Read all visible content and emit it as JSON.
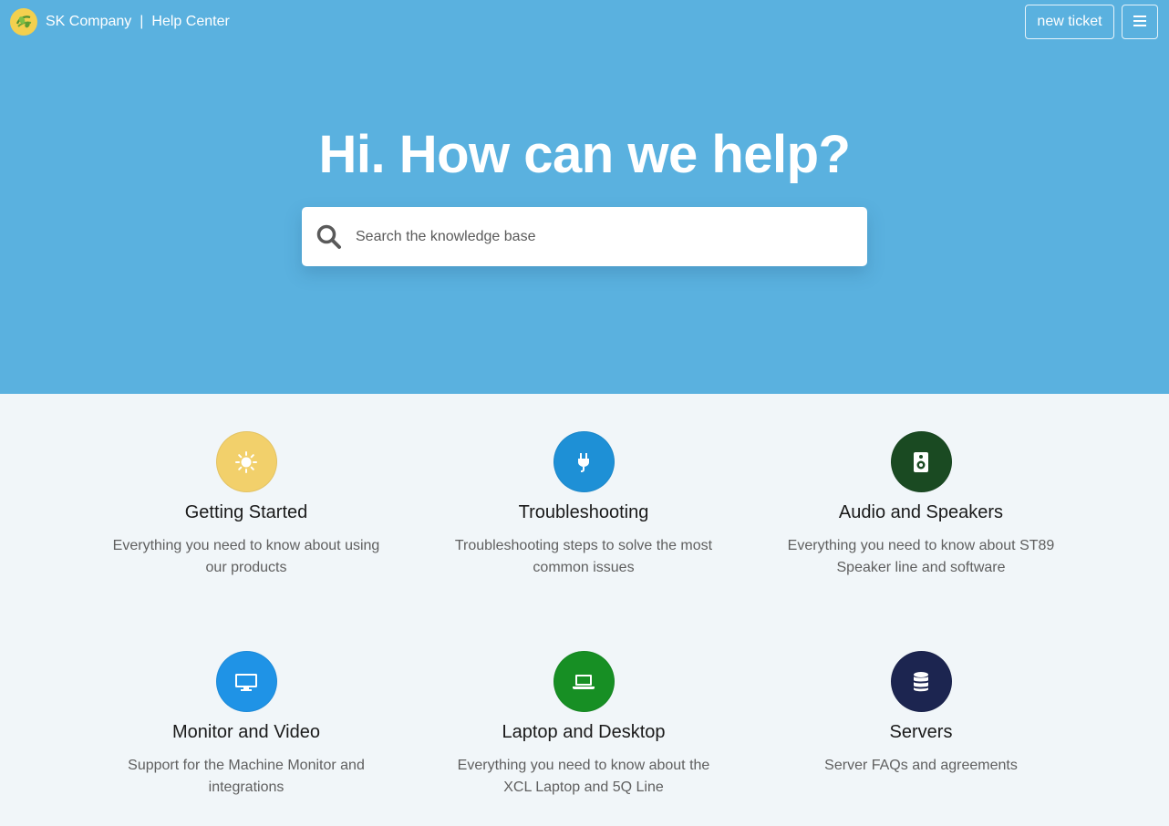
{
  "header": {
    "company": "SK Company",
    "separator": "|",
    "section": "Help Center",
    "new_ticket_label": "new ticket",
    "menu_icon": "hamburger-menu-icon"
  },
  "hero": {
    "title": "Hi. How can we help?",
    "background_color": "#5ab1df"
  },
  "search": {
    "placeholder": "Search the knowledge base",
    "value": ""
  },
  "categories": [
    {
      "title": "Getting Started",
      "desc_line1": "Everything you need to know about using",
      "desc_line2": "our products",
      "icon": "sun-icon",
      "color": "#f2d06b"
    },
    {
      "title": "Troubleshooting",
      "desc_line1": "Troubleshooting steps to solve the most",
      "desc_line2": "common issues",
      "icon": "plug-icon",
      "color": "#1e90d6"
    },
    {
      "title": "Audio and Speakers",
      "desc_line1": "Everything you need to know about ST89",
      "desc_line2": "Speaker line and software",
      "icon": "speaker-icon",
      "color": "#1a4a22"
    },
    {
      "title": "Monitor and Video",
      "desc_line1": "Support for the Machine Monitor and",
      "desc_line2": "integrations",
      "icon": "monitor-icon",
      "color": "#1f93e6"
    },
    {
      "title": "Laptop and Desktop",
      "desc_line1": "Everything you need to know about the",
      "desc_line2": "XCL Laptop and 5Q Line",
      "icon": "laptop-icon",
      "color": "#178f24"
    },
    {
      "title": "Servers",
      "desc_line1": "Server FAQs and agreements",
      "desc_line2": "",
      "icon": "database-icon",
      "color": "#1c2550"
    }
  ]
}
